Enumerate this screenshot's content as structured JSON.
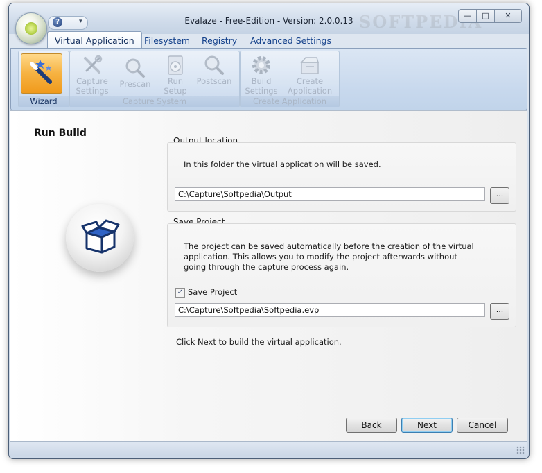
{
  "window": {
    "title": "Evalaze - Free-Edition - Version: 2.0.0.13",
    "watermark": "SOFTPEDIA",
    "minimize_glyph": "—",
    "maximize_glyph": "□",
    "close_glyph": "✕"
  },
  "quick_access": {
    "help_glyph": "?",
    "dropdown_glyph": "▾"
  },
  "tabs": [
    {
      "label": "Virtual Application",
      "active": true
    },
    {
      "label": "Filesystem",
      "active": false
    },
    {
      "label": "Registry",
      "active": false
    },
    {
      "label": "Advanced Settings",
      "active": false
    }
  ],
  "ribbon": {
    "wizard_group": {
      "label": "Wizard"
    },
    "capture_group": {
      "label": "Capture System",
      "buttons": [
        "Capture Settings",
        "Prescan",
        "Run Setup",
        "Postscan"
      ]
    },
    "create_group": {
      "label": "Create Application",
      "buttons": [
        "Build Settings",
        "Create Application"
      ]
    }
  },
  "page": {
    "heading": "Run Build",
    "output": {
      "title": "Output location",
      "note": "In this folder the virtual application will be saved.",
      "path": "C:\\Capture\\Softpedia\\Output",
      "browse_label": "..."
    },
    "save_project": {
      "title": "Save Project",
      "note": "The project can be saved automatically before the creation of the virtual application. This allows you to modify the project afterwards without going through the capture process again.",
      "checkbox_label": "Save Project",
      "checked": true,
      "check_glyph": "✓",
      "path": "C:\\Capture\\Softpedia\\Softpedia.evp",
      "browse_label": "..."
    },
    "footer_note": "Click Next to build the virtual application."
  },
  "buttons": {
    "back": "Back",
    "next": "Next",
    "cancel": "Cancel"
  },
  "colors": {
    "ribbon_text": "#15428b",
    "wizard_highlight": "#f6b241",
    "disabled_text": "#a9b4c4"
  }
}
